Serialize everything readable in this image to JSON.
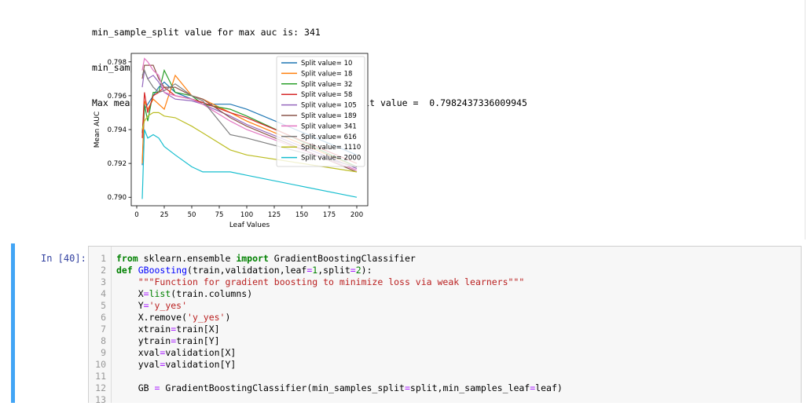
{
  "output": {
    "lines": [
      "min_sample_split value for max auc is: 341",
      "min_sample_leaf value for max auc is: 7",
      "Max mean AUC corresponding to optimal leaf and split value =  0.7982437336009945"
    ]
  },
  "chart_data": {
    "type": "line",
    "xlabel": "Leaf Values",
    "ylabel": "Mean AUC",
    "xlim": [
      -5,
      210
    ],
    "ylim": [
      0.7895,
      0.7985
    ],
    "xticks": [
      0,
      25,
      50,
      75,
      100,
      125,
      150,
      175,
      200
    ],
    "yticks": [
      0.79,
      0.792,
      0.794,
      0.796,
      0.798
    ],
    "xtick_labels": [
      "0",
      "25",
      "50",
      "75",
      "100",
      "125",
      "150",
      "175",
      "200"
    ],
    "ytick_labels": [
      "0.790",
      "0.792",
      "0.794",
      "0.796",
      "0.798"
    ],
    "grid": false,
    "legend_position": "upper-right",
    "x": [
      5,
      7,
      10,
      15,
      20,
      25,
      35,
      50,
      60,
      85,
      100,
      200
    ],
    "series": [
      {
        "name": "Split value= 10",
        "color": "#1f77b4",
        "values": [
          0.7919,
          0.7952,
          0.7955,
          0.796,
          0.7965,
          0.7968,
          0.7962,
          0.7958,
          0.7955,
          0.7955,
          0.7952,
          0.7925
        ]
      },
      {
        "name": "Split value= 18",
        "color": "#ff7f0e",
        "values": [
          0.792,
          0.7957,
          0.7952,
          0.7958,
          0.7955,
          0.7952,
          0.7972,
          0.796,
          0.7958,
          0.795,
          0.7945,
          0.7918
        ]
      },
      {
        "name": "Split value= 32",
        "color": "#2ca02c",
        "values": [
          0.7938,
          0.7955,
          0.7945,
          0.7962,
          0.7962,
          0.7975,
          0.7962,
          0.796,
          0.7955,
          0.7952,
          0.7948,
          0.7918
        ]
      },
      {
        "name": "Split value= 58",
        "color": "#d62728",
        "values": [
          0.7935,
          0.7962,
          0.795,
          0.796,
          0.7962,
          0.7965,
          0.796,
          0.7958,
          0.7956,
          0.795,
          0.7947,
          0.792
        ]
      },
      {
        "name": "Split value= 105",
        "color": "#9467bd",
        "values": [
          0.7965,
          0.7975,
          0.797,
          0.7972,
          0.7968,
          0.7962,
          0.7958,
          0.7957,
          0.7955,
          0.7948,
          0.7943,
          0.7917
        ]
      },
      {
        "name": "Split value= 189",
        "color": "#8c564b",
        "values": [
          0.797,
          0.7978,
          0.7978,
          0.7978,
          0.797,
          0.7965,
          0.7965,
          0.796,
          0.7958,
          0.7947,
          0.7942,
          0.7915
        ]
      },
      {
        "name": "Split value= 341",
        "color": "#e377c2",
        "values": [
          0.7975,
          0.7982,
          0.798,
          0.7975,
          0.7972,
          0.7962,
          0.796,
          0.7958,
          0.7955,
          0.7945,
          0.794,
          0.7916
        ]
      },
      {
        "name": "Split value= 616",
        "color": "#7f7f7f",
        "values": [
          0.7972,
          0.7975,
          0.797,
          0.7965,
          0.7962,
          0.7963,
          0.7967,
          0.796,
          0.7957,
          0.7937,
          0.7935,
          0.7918
        ]
      },
      {
        "name": "Split value= 1110",
        "color": "#bcbd22",
        "values": [
          0.794,
          0.7945,
          0.7948,
          0.795,
          0.795,
          0.7948,
          0.7947,
          0.7942,
          0.7938,
          0.7928,
          0.7925,
          0.7915
        ]
      },
      {
        "name": "Split value= 2000",
        "color": "#17becf",
        "values": [
          0.7899,
          0.794,
          0.7935,
          0.7937,
          0.7935,
          0.793,
          0.7925,
          0.7918,
          0.7915,
          0.7915,
          0.7913,
          0.79
        ]
      }
    ]
  },
  "cell": {
    "prompt": "In [40]:",
    "lines": [
      {
        "n": "1",
        "segs": [
          [
            "kw",
            "from"
          ],
          [
            "t",
            " sklearn.ensemble "
          ],
          [
            "kw",
            "import"
          ],
          [
            "t",
            " GradientBoostingClassifier"
          ]
        ]
      },
      {
        "n": "2",
        "segs": [
          [
            "kw",
            "def"
          ],
          [
            "t",
            " "
          ],
          [
            "fn",
            "GBoosting"
          ],
          [
            "t",
            "(train,validation,leaf"
          ],
          [
            "op",
            "="
          ],
          [
            "num",
            "1"
          ],
          [
            "t",
            ",split"
          ],
          [
            "op",
            "="
          ],
          [
            "num",
            "2"
          ],
          [
            "t",
            "):"
          ]
        ]
      },
      {
        "n": "3",
        "segs": [
          [
            "t",
            "    "
          ],
          [
            "str",
            "\"\"\"Function for gradient boosting to minimize loss via weak learners\"\"\""
          ]
        ]
      },
      {
        "n": "4",
        "segs": [
          [
            "t",
            "    X"
          ],
          [
            "op",
            "="
          ],
          [
            "bi",
            "list"
          ],
          [
            "t",
            "(train.columns)"
          ]
        ]
      },
      {
        "n": "5",
        "segs": [
          [
            "t",
            "    Y"
          ],
          [
            "op",
            "="
          ],
          [
            "str",
            "'y_yes'"
          ]
        ]
      },
      {
        "n": "6",
        "segs": [
          [
            "t",
            "    X.remove("
          ],
          [
            "str",
            "'y_yes'"
          ],
          [
            "t",
            ")"
          ]
        ]
      },
      {
        "n": "7",
        "segs": [
          [
            "t",
            "    xtrain"
          ],
          [
            "op",
            "="
          ],
          [
            "t",
            "train[X]"
          ]
        ]
      },
      {
        "n": "8",
        "segs": [
          [
            "t",
            "    ytrain"
          ],
          [
            "op",
            "="
          ],
          [
            "t",
            "train[Y]"
          ]
        ]
      },
      {
        "n": "9",
        "segs": [
          [
            "t",
            "    xval"
          ],
          [
            "op",
            "="
          ],
          [
            "t",
            "validation[X]"
          ]
        ]
      },
      {
        "n": "10",
        "segs": [
          [
            "t",
            "    yval"
          ],
          [
            "op",
            "="
          ],
          [
            "t",
            "validation[Y]"
          ]
        ]
      },
      {
        "n": "11",
        "segs": []
      },
      {
        "n": "12",
        "segs": [
          [
            "t",
            "    GB "
          ],
          [
            "op",
            "="
          ],
          [
            "t",
            " GradientBoostingClassifier(min_samples_split"
          ],
          [
            "op",
            "="
          ],
          [
            "t",
            "split,min_samples_leaf"
          ],
          [
            "op",
            "="
          ],
          [
            "t",
            "leaf)"
          ]
        ]
      },
      {
        "n": "13",
        "segs": []
      }
    ]
  }
}
